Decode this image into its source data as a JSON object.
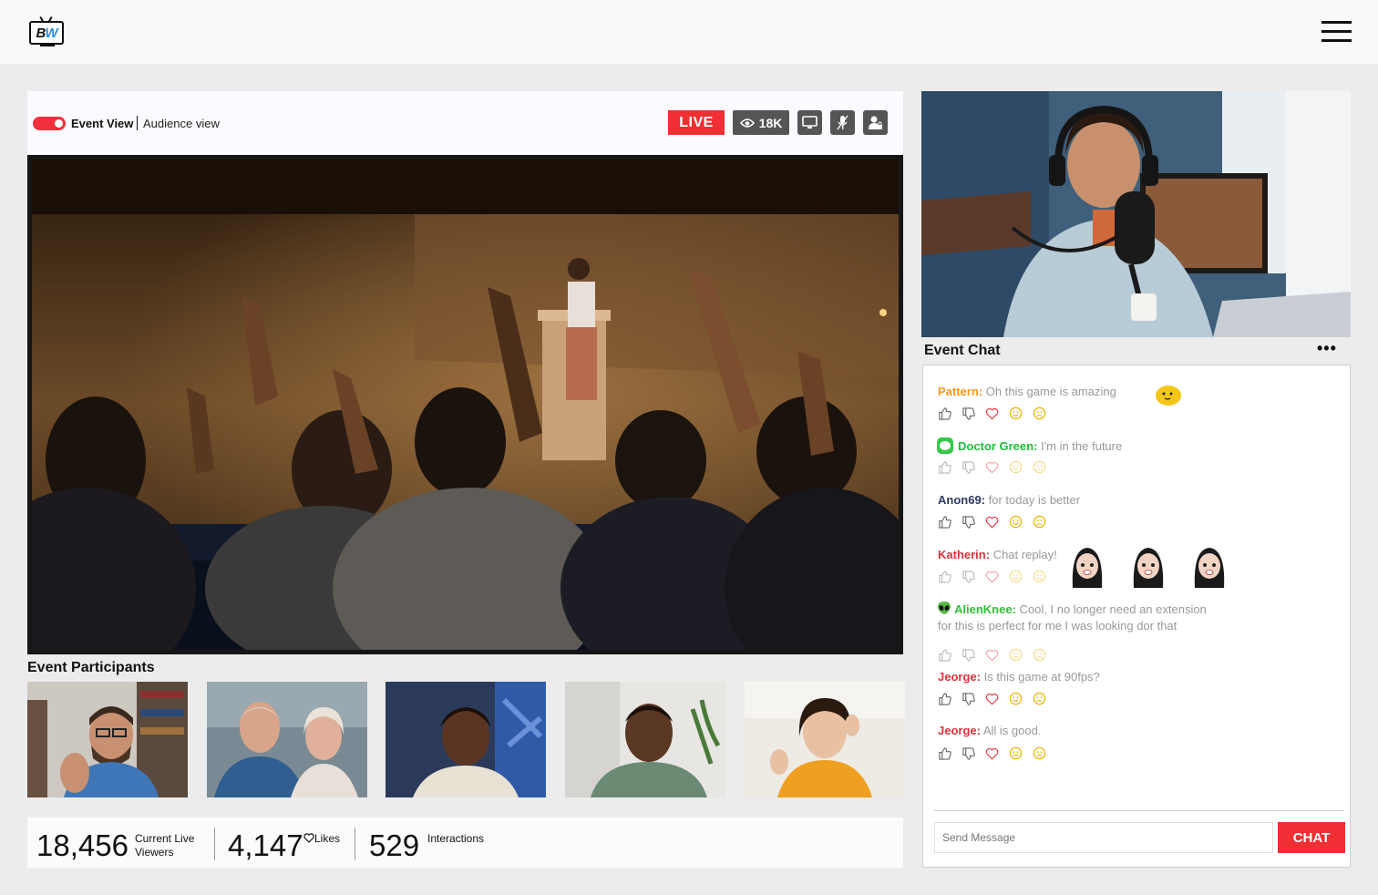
{
  "app": {
    "logo_b": "B",
    "logo_w": "W",
    "logo_icon": "tv-logo-icon",
    "menu_icon": "hamburger-menu-icon"
  },
  "event": {
    "view_label": "Event View",
    "audience_label": "Audience view",
    "toggle_on": true,
    "live_label": "LIVE",
    "viewers_count": "18K",
    "tools": [
      "screen-share-icon",
      "mic-muted-icon",
      "user-lock-icon"
    ]
  },
  "participants": {
    "title": "Event Participants",
    "count": 5
  },
  "stats": {
    "viewers_value": "18,456",
    "viewers_label_1": "Current Live",
    "viewers_label_2": "Viewers",
    "likes_value": "4,147",
    "likes_label": "Likes",
    "interactions_value": "529",
    "interactions_label": "Interactions"
  },
  "chat": {
    "title": "Event Chat",
    "messages": [
      {
        "name": "Pattern:",
        "text": "Oh this game is amazing",
        "color": "#f59a1b"
      },
      {
        "name": "Doctor Green:",
        "text": "I'm in the future",
        "color": "#1fbf3a"
      },
      {
        "name": "Anon69:",
        "text": "for today is better",
        "color": "#2b3a66"
      },
      {
        "name": "Katherin:",
        "text": "Chat replay!",
        "color": "#d8333b"
      },
      {
        "name": "AlienKnee:",
        "text": "Cool, I no longer need an extension",
        "text2": "for this is perfect  for me I was looking dor that",
        "color": "#31c03a"
      },
      {
        "name": "Jeorge:",
        "text": "Is this game at 90fps?",
        "color": "#d8333b"
      },
      {
        "name": "Jeorge:",
        "text": "All is good.",
        "color": "#d8333b"
      }
    ],
    "input_placeholder": "Send Message",
    "send_label": "CHAT"
  },
  "colors": {
    "accent": "#ef2f34",
    "badge_gray": "#555555"
  }
}
